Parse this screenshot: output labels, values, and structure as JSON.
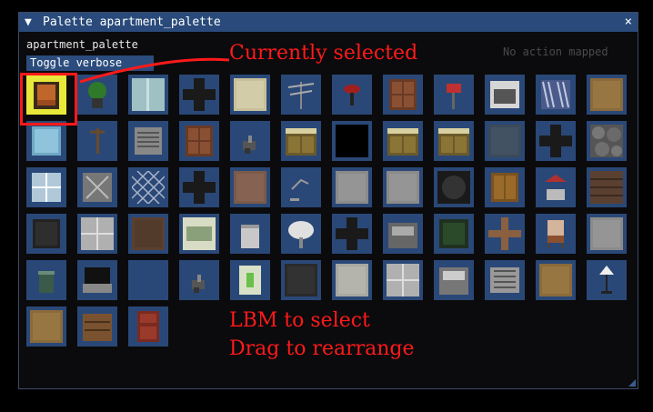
{
  "window": {
    "collapse_arrow": "▼",
    "title": "Palette apartment_palette",
    "close_glyph": "×"
  },
  "palette_name": "apartment_palette",
  "verbose_button_label": "Toggle verbose mode",
  "no_action_text": "No action mapped",
  "annotations": {
    "currently_selected": "Currently selected",
    "lbm_to_select": "LBM to select",
    "drag_to_rearrange": "Drag to rearrange"
  },
  "colors": {
    "tile_bg": "#2a4877",
    "selected_bg": "#e8e83a",
    "annotation": "#ff1a1a"
  },
  "tiles": [
    "armchair-icon",
    "potted-plant-icon",
    "glass-wall-icon",
    "wall-cross-icon",
    "carpet-icon",
    "tv-antenna-icon",
    "bar-stool-icon",
    "wooden-door-icon",
    "mailbox-icon",
    "stove-icon",
    "curtain-icon",
    "wood-floor-icon",
    "window-pane-icon",
    "coat-rack-icon",
    "vent-icon",
    "wooden-door-icon",
    "faucet-icon",
    "kitchen-cabinet-icon",
    "void-icon",
    "kitchen-cabinet-icon",
    "kitchen-cabinet-icon",
    "concrete-icon",
    "wall-cross-icon",
    "stone-wall-icon",
    "bay-window-icon",
    "barred-window-icon",
    "chain-fence-icon",
    "wall-cross-icon",
    "brown-floor-icon",
    "desk-lamp-icon",
    "grey-floor-icon",
    "grey-floor-icon",
    "dark-hole-icon",
    "wardrobe-icon",
    "well-icon",
    "brick-wall-icon",
    "safe-door-icon",
    "tile-floor-icon",
    "dirt-floor-icon",
    "window-frame-icon",
    "trash-bin-icon",
    "satellite-dish-icon",
    "wall-cross-icon",
    "sink-icon",
    "green-window-icon",
    "wood-cross-icon",
    "chair-icon",
    "grey-floor-icon",
    "trash-can-icon",
    "laptop-icon",
    "empty-icon",
    "faucet-icon",
    "light-switch-icon",
    "dark-carpet-icon",
    "light-floor-icon",
    "tile-floor-icon",
    "sink-counter-icon",
    "radiator-icon",
    "wood-floor-icon",
    "floor-lamp-icon",
    "wood-floor-icon",
    "dresser-icon",
    "red-door-icon"
  ]
}
